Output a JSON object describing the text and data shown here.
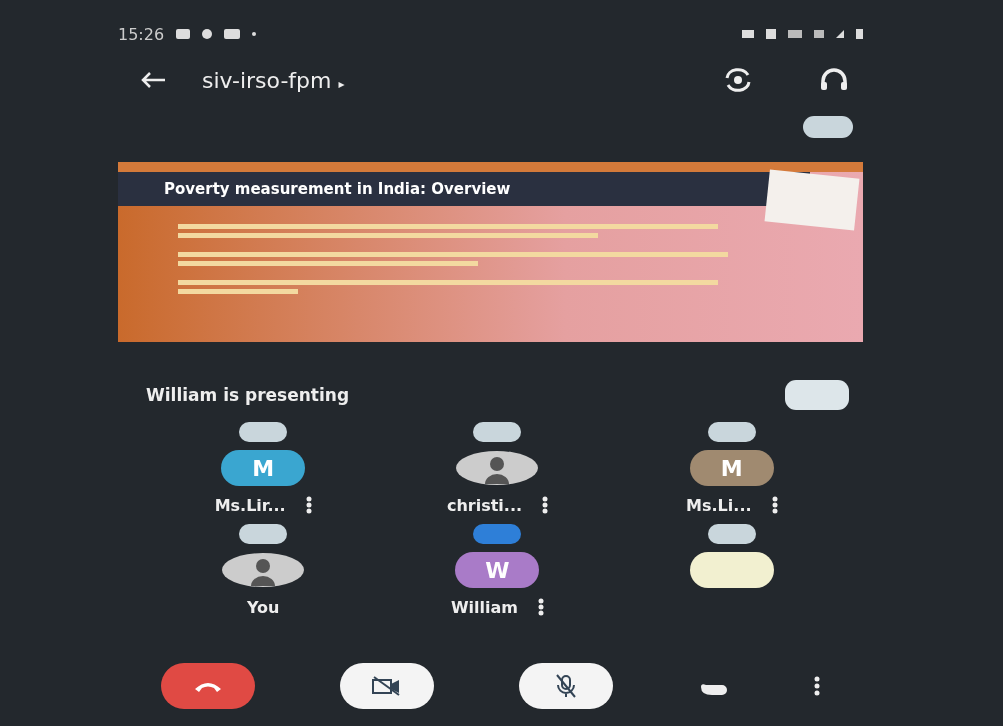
{
  "status_bar": {
    "time": "15:26"
  },
  "header": {
    "title": "siv-irso-fpm",
    "title_caret": "▸"
  },
  "slide": {
    "title": "Poverty measurement in India: Overview"
  },
  "presenting_label": "William is presenting",
  "participants": [
    {
      "name": "Ms.Lir...",
      "kind": "letter",
      "letter": "M",
      "color": "#3aa6d0",
      "speaking": false,
      "menu": true
    },
    {
      "name": "christi...",
      "kind": "photo",
      "speaking": false,
      "menu": true
    },
    {
      "name": "Ms.Li...",
      "kind": "letter",
      "letter": "M",
      "color": "#a08a70",
      "speaking": false,
      "menu": true
    },
    {
      "name": "You",
      "kind": "photo",
      "speaking": false,
      "menu": false
    },
    {
      "name": "William",
      "kind": "letter",
      "letter": "W",
      "color": "#a97bc8",
      "speaking": true,
      "menu": true
    },
    {
      "kind": "blank",
      "color": "#f2f0d0",
      "speaking": false,
      "menu": false
    }
  ]
}
